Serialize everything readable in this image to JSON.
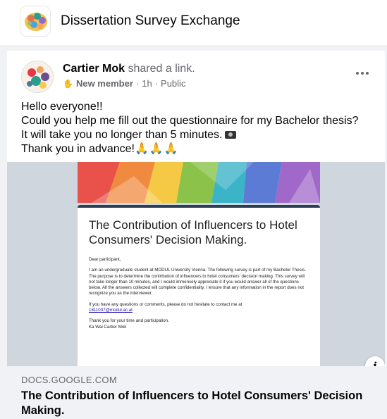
{
  "group": {
    "name": "Dissertation Survey Exchange",
    "icon": "brain-logo-icon"
  },
  "post": {
    "author": "Cartier Mok",
    "action": "shared a link.",
    "badge_icon": "wave-icon",
    "member_label": "New member",
    "time": "1h",
    "visibility": "Public",
    "more_icon": "more-options-icon",
    "lines": [
      "Hello everyone!!",
      "Could you help me fill out the questionnaire for my Bachelor thesis?",
      "It will take you no longer than 5 minutes.",
      "Thank you in advance!"
    ],
    "hands": "🙏🙏🙏"
  },
  "preview_form": {
    "title": "The Contribution of Influencers to Hotel Consumers' Decision Making.",
    "greeting": "Dear participant,",
    "intro": "I am an undergraduate student at MODUL University Vienna. The following survey is part of my Bachelor Thesis. The purpose is to determine the contribution of influencers to hotel consumers' decision making. This survey will not take longer than 10 minutes, and I would immensely appreciate it if you would answer all of the questions below. All the answers collected will complete confidentiality. I ensure that any information in the report does not recognize you as the interviewer.",
    "contact": "If you have any questions or comments, please do not hesitate to contact me at",
    "email": "1811037@modul.ac.at",
    "thanks": "Thank you for your time and participation.",
    "signature": "Ka Wai Cartier Mok"
  },
  "link": {
    "domain": "DOCS.GOOGLE.COM",
    "title": "The Contribution of Influencers to Hotel Consumers' Decision Making.",
    "info_icon": "info-icon",
    "info_glyph": "i"
  },
  "colors": {
    "header_bar": "#2b3e55",
    "link_text": "#1a0dab",
    "muted": "#65676b"
  }
}
